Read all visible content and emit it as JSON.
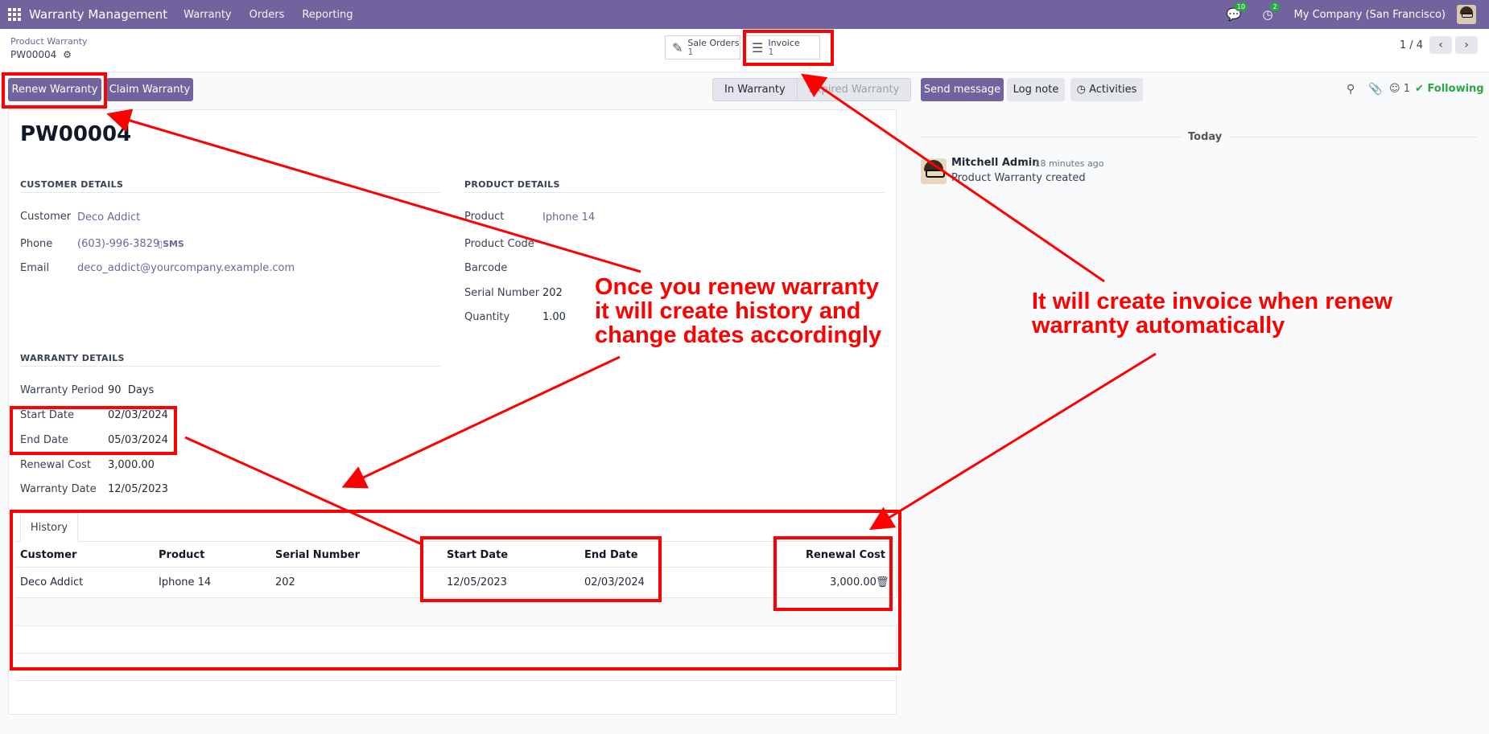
{
  "navbar": {
    "app_name": "Warranty Management",
    "menu": [
      "Warranty",
      "Orders",
      "Reporting"
    ],
    "messages_count": "10",
    "activities_count": "2",
    "company": "My Company (San Francisco)"
  },
  "breadcrumb": {
    "parent": "Product Warranty",
    "current": "PW00004"
  },
  "smart_buttons": {
    "sale_orders": {
      "label": "Sale Orders",
      "count": "1"
    },
    "invoice": {
      "label": "Invoice",
      "count": "1"
    }
  },
  "pager": {
    "text": "1 / 4"
  },
  "actions": {
    "renew": "Renew Warranty",
    "claim": "Claim Warranty"
  },
  "status": {
    "stages": [
      "In Warranty",
      "Expired Warranty"
    ],
    "active": "In Warranty"
  },
  "chatter_actions": {
    "send_message": "Send message",
    "log_note": "Log note",
    "activities": "Activities",
    "followers_count": "1",
    "following": "Following"
  },
  "record": {
    "name": "PW00004",
    "customer_section": "CUSTOMER DETAILS",
    "product_section": "PRODUCT DETAILS",
    "warranty_section": "WARRANTY DETAILS",
    "customer": {
      "label": "Customer",
      "value": "Deco Addict"
    },
    "phone": {
      "label": "Phone",
      "value": "(603)-996-3829",
      "sms": "SMS"
    },
    "email": {
      "label": "Email",
      "value": "deco_addict@yourcompany.example.com"
    },
    "product": {
      "label": "Product",
      "value": "Iphone 14"
    },
    "product_code": {
      "label": "Product Code",
      "value": ""
    },
    "barcode": {
      "label": "Barcode",
      "value": ""
    },
    "serial_number": {
      "label": "Serial Number",
      "value": "202"
    },
    "quantity": {
      "label": "Quantity",
      "value": "1.00"
    },
    "warranty_period": {
      "label": "Warranty Period",
      "value": "90",
      "unit": "Days"
    },
    "start_date": {
      "label": "Start Date",
      "value": "02/03/2024"
    },
    "end_date": {
      "label": "End Date",
      "value": "05/03/2024"
    },
    "renewal_cost": {
      "label": "Renewal Cost",
      "value": "3,000.00"
    },
    "warranty_date": {
      "label": "Warranty Date",
      "value": "12/05/2023"
    }
  },
  "history": {
    "tab": "History",
    "columns": [
      "Customer",
      "Product",
      "Serial Number",
      "Start Date",
      "End Date",
      "Renewal Cost"
    ],
    "rows": [
      [
        "Deco Addict",
        "Iphone 14",
        "202",
        "12/05/2023",
        "02/03/2024",
        "3,000.00"
      ]
    ]
  },
  "chatter": {
    "date_separator": "Today",
    "messages": [
      {
        "author": "Mitchell Admin",
        "time": "- 18 minutes ago",
        "body": "Product Warranty created"
      }
    ]
  },
  "annotations": {
    "renew_note": [
      "Once you renew warranty",
      "it will create history and",
      "change dates accordingly"
    ],
    "invoice_note": [
      "It will create invoice when renew",
      "warranty automatically"
    ],
    "color": "#ff0000"
  }
}
